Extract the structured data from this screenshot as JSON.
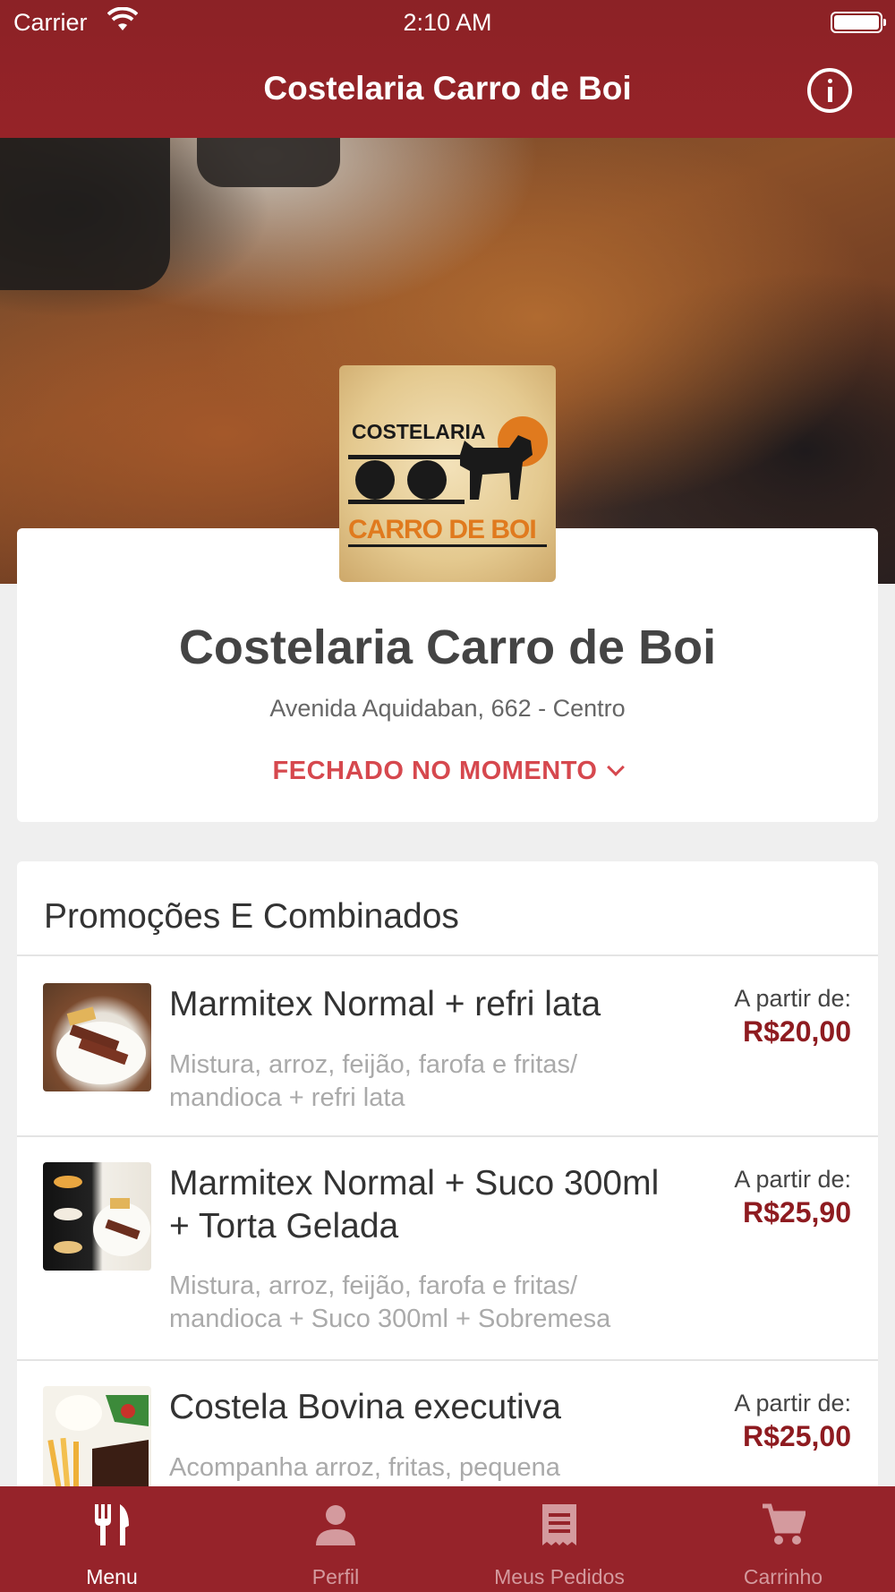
{
  "status_bar": {
    "carrier": "Carrier",
    "time": "2:10 AM"
  },
  "nav": {
    "title": "Costelaria Carro de Boi",
    "info_icon": "info-circle-icon"
  },
  "logo": {
    "line1": "COSTELARIA",
    "line2": "CARRO DE BOI"
  },
  "restaurant": {
    "name": "Costelaria Carro de Boi",
    "address": "Avenida Aquidaban, 662 - Centro",
    "status": "FECHADO NO MOMENTO"
  },
  "menu": {
    "section_title": "Promoções E Combinados",
    "items": [
      {
        "name": "Marmitex Normal + refri lata",
        "description": "Mistura, arroz, feijão, farofa e fritas/ mandioca + refri lata",
        "from_label": "A partir de:",
        "price": "R$20,00"
      },
      {
        "name": "Marmitex Normal + Suco 300ml + Torta Gelada",
        "description": "Mistura, arroz, feijão, farofa e fritas/ mandioca + Suco 300ml + Sobremesa",
        "from_label": "A partir de:",
        "price": "R$25,90"
      },
      {
        "name": "Costela Bovina executiva",
        "description": "Acompanha arroz, fritas, pequena",
        "from_label": "A partir de:",
        "price": "R$25,00"
      }
    ]
  },
  "tabs": [
    {
      "label": "Menu",
      "icon": "fork-knife-icon",
      "active": true
    },
    {
      "label": "Perfil",
      "icon": "person-icon",
      "active": false
    },
    {
      "label": "Meus Pedidos",
      "icon": "receipt-icon",
      "active": false
    },
    {
      "label": "Carrinho",
      "icon": "cart-icon",
      "active": false
    }
  ],
  "colors": {
    "brand": "#96232a",
    "status_closed": "#d6484e",
    "price": "#8e1b20"
  }
}
